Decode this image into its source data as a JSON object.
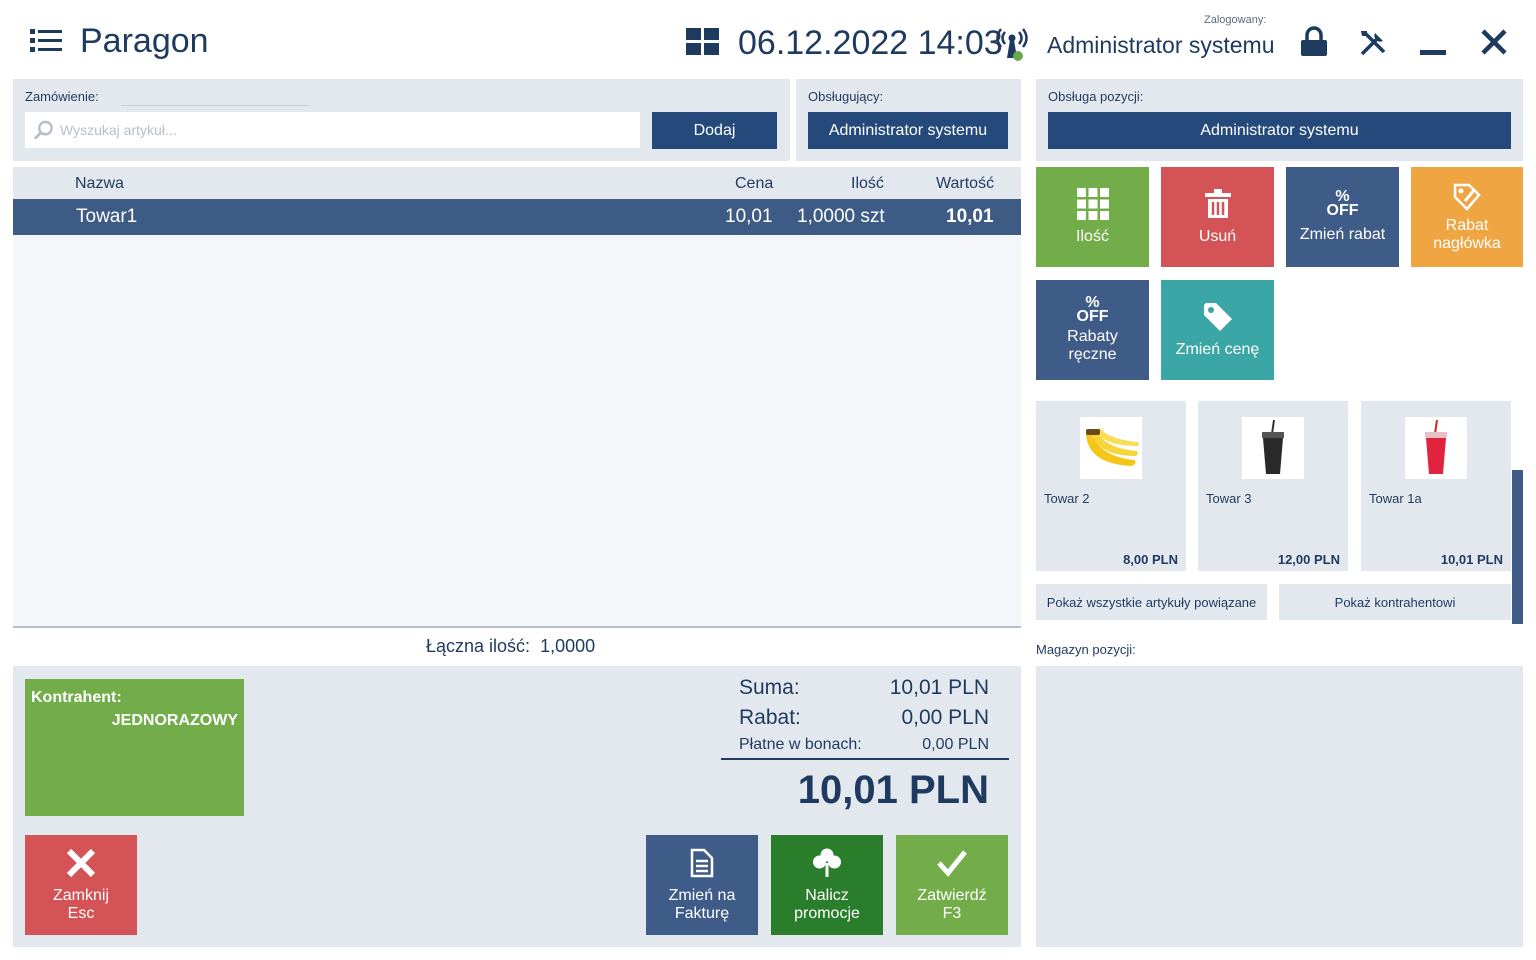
{
  "header": {
    "title": "Paragon",
    "datetime": "06.12.2022 14:03",
    "logged_label": "Zalogowany:",
    "logged_user": "Administrator systemu"
  },
  "order": {
    "label": "Zamówienie:",
    "search_placeholder": "Wyszukaj artykuł...",
    "add_button": "Dodaj"
  },
  "staff": {
    "label": "Obsługujący:",
    "value": "Administrator systemu"
  },
  "position_service": {
    "label": "Obsługa pozycji:",
    "value": "Administrator systemu"
  },
  "table": {
    "headers": {
      "name": "Nazwa",
      "price": "Cena",
      "qty": "Ilość",
      "value": "Wartość"
    },
    "rows": [
      {
        "name": "Towar1",
        "price": "10,01",
        "qty": "1,0000 szt",
        "value": "10,01"
      }
    ],
    "total_qty_label": "Łączna ilość:",
    "total_qty_value": "1,0000"
  },
  "customer": {
    "label": "Kontrahent:",
    "value": "JEDNORAZOWY"
  },
  "summary": {
    "sum_label": "Suma:",
    "sum_value": "10,01 PLN",
    "discount_label": "Rabat:",
    "discount_value": "0,00 PLN",
    "vouchers_label": "Płatne w bonach:",
    "vouchers_value": "0,00 PLN",
    "total": "10,01 PLN"
  },
  "bottom_buttons": {
    "close_line1": "Zamknij",
    "close_line2": "Esc",
    "invoice_line1": "Zmień na",
    "invoice_line2": "Fakturę",
    "promo_line1": "Nalicz",
    "promo_line2": "promocje",
    "confirm_line1": "Zatwierdź",
    "confirm_line2": "F3"
  },
  "actions": {
    "qty": "Ilość",
    "delete": "Usuń",
    "change_discount": "Zmień rabat",
    "header_discount_line1": "Rabat",
    "header_discount_line2": "nagłówka",
    "manual_discount_line1": "Rabaty",
    "manual_discount_line2": "ręczne",
    "change_price": "Zmień cenę",
    "percent": "%",
    "off": "OFF"
  },
  "products": [
    {
      "name": "Towar 2",
      "price": "8,00 PLN",
      "icon": "banana"
    },
    {
      "name": "Towar 3",
      "price": "12,00 PLN",
      "icon": "dark-cup"
    },
    {
      "name": "Towar 1a",
      "price": "10,01 PLN",
      "icon": "red-cup"
    }
  ],
  "links": {
    "show_related": "Pokaż wszystkie artykuły powiązane",
    "show_customer": "Pokaż kontrahentowi"
  },
  "warehouse_label": "Magazyn pozycji:",
  "colors": {
    "primary": "#25497a",
    "green": "#73ad4a",
    "red": "#d35356",
    "orange": "#efa541",
    "teal": "#3aa6a5",
    "dark_green": "#2a7d2a",
    "panel": "#e3e7ee"
  }
}
